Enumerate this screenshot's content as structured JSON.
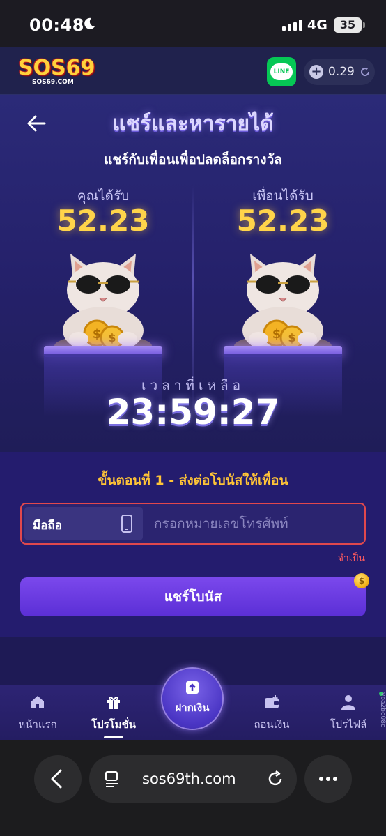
{
  "status": {
    "time": "00:48",
    "network": "4G",
    "battery": "35"
  },
  "header": {
    "logo_text": "SOS69",
    "logo_sub": "SOS69.COM",
    "line_label": "LINE",
    "balance": "0.29"
  },
  "hero": {
    "title": "แชร์และหารายได้",
    "subtitle": "แชร์กับเพื่อนเพื่อปลดล็อกรางวัล",
    "you_label": "คุณได้รับ",
    "you_value": "52.23",
    "friend_label": "เพื่อนได้รับ",
    "friend_value": "52.23",
    "timer_label": "เวลาที่เหลือ",
    "timer": "23:59:27"
  },
  "step": {
    "title": "ขั้นตอนที่ 1 - ส่งต่อโบนัสให้เพื่อน",
    "phone_type": "มือถือ",
    "phone_placeholder": "กรอกหมายเลขโทรศัพท์",
    "required": "จำเป็น",
    "share_button": "แชร์โบนัส"
  },
  "nav": {
    "items": [
      {
        "label": "หน้าแรก",
        "icon": "home-icon"
      },
      {
        "label": "โปรโมชั่น",
        "icon": "gift-icon",
        "active": true
      },
      {
        "label": "ฝากเงิน",
        "icon": "deposit-icon"
      },
      {
        "label": "ถอนเงิน",
        "icon": "wallet-icon"
      },
      {
        "label": "โปรไฟล์",
        "icon": "user-icon"
      }
    ],
    "side_id": "vba2be08c"
  },
  "browser": {
    "url": "sos69th.com"
  },
  "colors": {
    "accent": "#6a3fe0",
    "gold": "#ffd44a",
    "required": "#ff5a5f",
    "line_green": "#06c755"
  }
}
